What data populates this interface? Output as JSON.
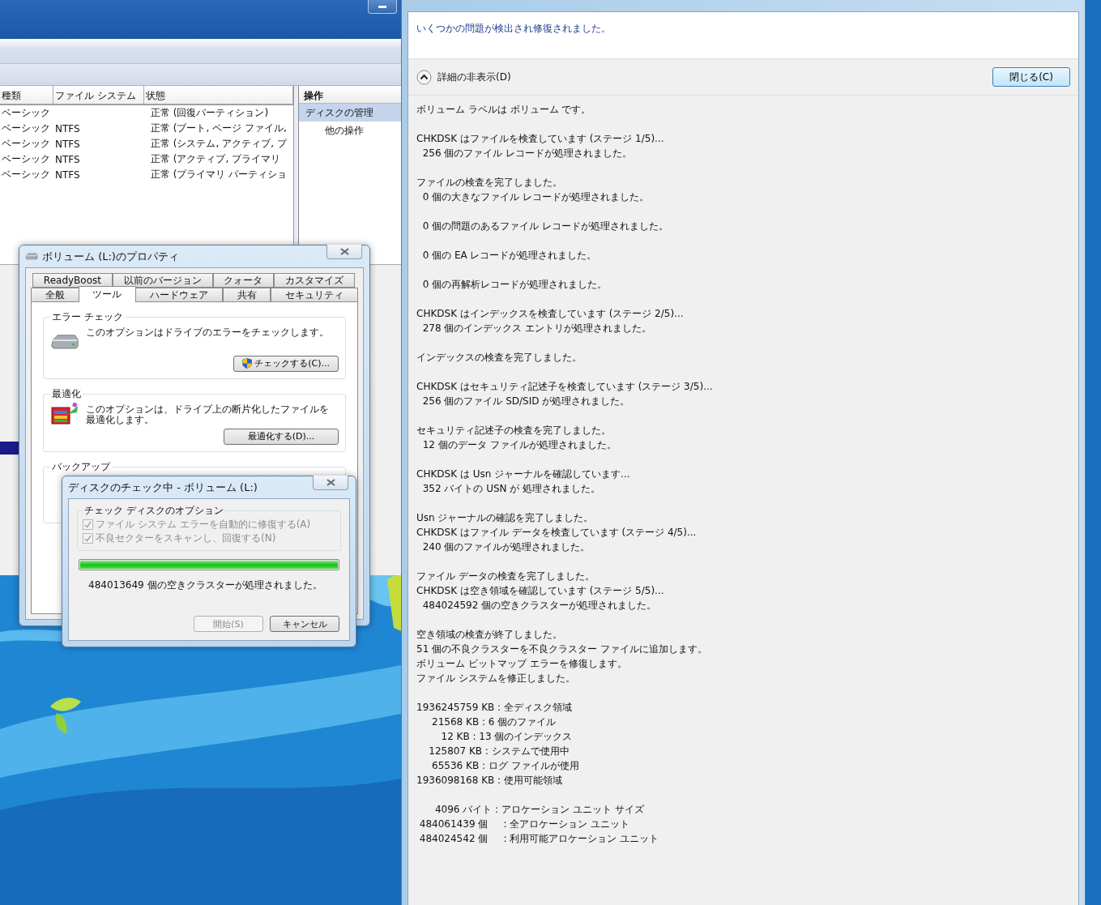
{
  "disk_management": {
    "table": {
      "columns": [
        "種類",
        "ファイル システム",
        "状態"
      ],
      "rows": [
        {
          "type": "ベーシック",
          "status": "正常 (回復パーティション)"
        },
        {
          "type": "ベーシック",
          "fs": "NTFS",
          "status": "正常 (ブート, ページ ファイル,"
        },
        {
          "type": "ベーシック",
          "fs": "NTFS",
          "status": "正常 (システム, アクティブ, プ"
        },
        {
          "type": "ベーシック",
          "fs": "NTFS",
          "status": "正常 (アクティブ, プライマリ"
        },
        {
          "type": "ベーシック",
          "fs": "NTFS",
          "status": "正常 (プライマリ パーティショ"
        }
      ]
    },
    "actions": {
      "header": "操作",
      "items": [
        {
          "label": "ディスクの管理",
          "selected": true
        },
        {
          "label": "他の操作",
          "selected": false
        }
      ]
    }
  },
  "properties_dialog": {
    "title": "ボリューム (L:)のプロパティ",
    "tab_rows": [
      [
        {
          "label": "ReadyBoost",
          "selected": false
        },
        {
          "label": "以前のバージョン",
          "selected": false
        },
        {
          "label": "クォータ",
          "selected": false
        },
        {
          "label": "カスタマイズ",
          "selected": false
        }
      ],
      [
        {
          "label": "全般",
          "selected": false
        },
        {
          "label": "ツール",
          "selected": true
        },
        {
          "label": "ハードウェア",
          "selected": false
        },
        {
          "label": "共有",
          "selected": false
        },
        {
          "label": "セキュリティ",
          "selected": false
        }
      ]
    ],
    "groups": [
      {
        "kind": "error_check",
        "title": "エラー チェック",
        "text": "このオプションはドライブのエラーをチェックします。",
        "button": "チェックする(C)..."
      },
      {
        "kind": "defrag",
        "title": "最適化",
        "text": "このオプションは、ドライブ上の断片化したファイルを最適化します。",
        "button": "最適化する(D)..."
      },
      {
        "kind": "backup",
        "title": "バックアップ"
      }
    ]
  },
  "check_dialog": {
    "title": "ディスクのチェック中 - ボリューム (L:)",
    "options_title": "チェック ディスクのオプション",
    "options": [
      {
        "label": "ファイル システム エラーを自動的に修復する(A)",
        "checked": true,
        "disabled": true
      },
      {
        "label": "不良セクターをスキャンし、回復する(N)",
        "checked": true,
        "disabled": true
      }
    ],
    "progress": {
      "level": 1
    },
    "status": "484013649 個の空きクラスターが処理されました。",
    "buttons": [
      {
        "label": "開始(S)",
        "disabled": true
      },
      {
        "label": "キャンセル",
        "disabled": false
      }
    ]
  },
  "result_window": {
    "message": "いくつかの問題が検出され修復されました。",
    "details_toggle": {
      "label": "詳細の非表示(D)",
      "expanded": true
    },
    "close_button": "閉じる(C)",
    "log": [
      [
        "ボリューム ラベルは ボリューム です。"
      ],
      [
        "CHKDSK はファイルを検査しています (ステージ 1/5)...",
        "  256 個のファイル レコードが処理されました。"
      ],
      [
        "ファイルの検査を完了しました。",
        "  0 個の大きなファイル レコードが処理されました。"
      ],
      [
        "  0 個の問題のあるファイル レコードが処理されました。"
      ],
      [
        "  0 個の EA レコードが処理されました。"
      ],
      [
        "  0 個の再解析レコードが処理されました。"
      ],
      [
        "CHKDSK はインデックスを検査しています (ステージ 2/5)...",
        "  278 個のインデックス エントリが処理されました。"
      ],
      [
        "インデックスの検査を完了しました。"
      ],
      [
        "CHKDSK はセキュリティ記述子を検査しています (ステージ 3/5)...",
        "  256 個のファイル SD/SID が処理されました。"
      ],
      [
        "セキュリティ記述子の検査を完了しました。",
        "  12 個のデータ ファイルが処理されました。"
      ],
      [
        "CHKDSK は Usn ジャーナルを確認しています...",
        "  352 バイトの USN が 処理されました。"
      ],
      [
        "Usn ジャーナルの確認を完了しました。",
        "CHKDSK はファイル データを検査しています (ステージ 4/5)...",
        "  240 個のファイルが処理されました。"
      ],
      [
        "ファイル データの検査を完了しました。",
        "CHKDSK は空き領域を確認しています (ステージ 5/5)...",
        "  484024592 個の空きクラスターが処理されました。"
      ],
      [
        "空き領域の検査が終了しました。",
        "51 個の不良クラスターを不良クラスター ファイルに追加します。",
        "ボリューム ビットマップ エラーを修復します。",
        "ファイル システムを修正しました。"
      ],
      [
        "1936245759 KB : 全ディスク領域",
        "     21568 KB : 6 個のファイル",
        "        12 KB : 13 個のインデックス",
        "    125807 KB : システムで使用中",
        "     65536 KB : ログ ファイルが使用",
        "1936098168 KB : 使用可能領域"
      ],
      [
        "      4096 バイト : アロケーション ユニット サイズ",
        " 484061439 個     : 全アロケーション ユニット",
        " 484024542 個     : 利用可能アロケーション ユニット"
      ]
    ]
  }
}
